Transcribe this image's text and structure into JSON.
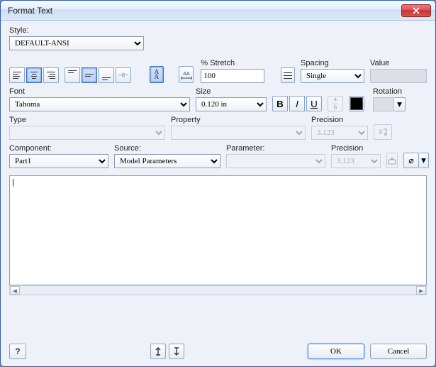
{
  "title": "Format Text",
  "style": {
    "label": "Style:",
    "value": "DEFAULT-ANSI"
  },
  "stretch": {
    "label": "% Stretch",
    "value": "100"
  },
  "spacing": {
    "label": "Spacing",
    "value": "Single"
  },
  "value": {
    "label": "Value",
    "text": ""
  },
  "font": {
    "label": "Font",
    "value": "Tahoma"
  },
  "size": {
    "label": "Size",
    "value": "0.120 in"
  },
  "rotation": {
    "label": "Rotation"
  },
  "type": {
    "label": "Type",
    "value": ""
  },
  "property": {
    "label": "Property",
    "value": ""
  },
  "precision1": {
    "label": "Precision",
    "value": "3.123"
  },
  "component": {
    "label": "Component:",
    "value": "Part1"
  },
  "source": {
    "label": "Source:",
    "value": "Model Parameters"
  },
  "parameter": {
    "label": "Parameter:",
    "value": ""
  },
  "precision2": {
    "label": "Precision",
    "value": "3.123"
  },
  "buttons": {
    "ok": "OK",
    "cancel": "Cancel"
  },
  "format_icons": {
    "bold": "B",
    "italic": "I",
    "underline": "U",
    "stack": "a/b"
  }
}
